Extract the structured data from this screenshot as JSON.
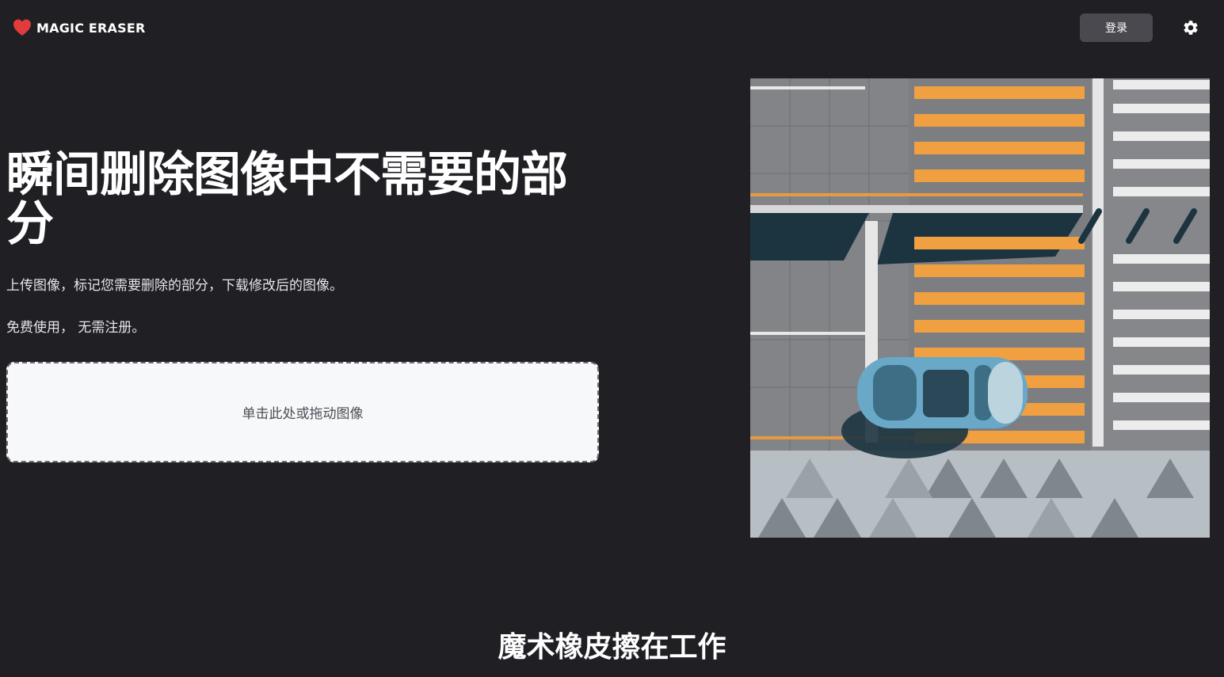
{
  "header": {
    "brand_name": "MAGIC ERASER",
    "brand_icon": "heart-icon",
    "brand_color": "#e03c3c",
    "login_label": "登录",
    "settings_icon": "gear-icon"
  },
  "hero": {
    "title": "瞬间删除图像中不需要的部分",
    "subtitle": "上传图像，标记您需要删除的部分，下载修改后的图像。",
    "free_note": "免费使用， 无需注册。",
    "dropzone_label": "单击此处或拖动图像"
  },
  "section": {
    "title": "魔术橡皮擦在工作"
  },
  "colors": {
    "background": "#201f24",
    "button_bg": "#4a4950",
    "dropzone_bg": "#f7f8fa",
    "road_stripe_orange": "#f0a040",
    "car_blue": "#6aa8c8"
  }
}
